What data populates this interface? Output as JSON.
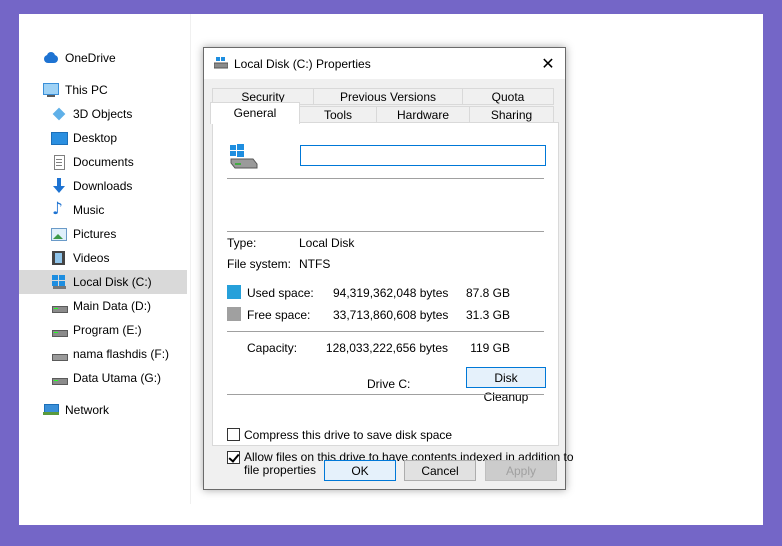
{
  "nav": {
    "items": [
      {
        "label": "OneDrive",
        "icon": "onedrive-icon"
      },
      {
        "label": "This PC",
        "icon": "this-pc-icon"
      },
      {
        "label": "3D Objects",
        "icon": "3d-objects-icon"
      },
      {
        "label": "Desktop",
        "icon": "desktop-icon"
      },
      {
        "label": "Documents",
        "icon": "documents-icon"
      },
      {
        "label": "Downloads",
        "icon": "downloads-icon"
      },
      {
        "label": "Music",
        "icon": "music-icon"
      },
      {
        "label": "Pictures",
        "icon": "pictures-icon"
      },
      {
        "label": "Videos",
        "icon": "videos-icon"
      },
      {
        "label": "Local Disk (C:)",
        "icon": "windows-drive-icon",
        "selected": true
      },
      {
        "label": "Main Data (D:)",
        "icon": "drive-icon"
      },
      {
        "label": "Program (E:)",
        "icon": "drive-icon"
      },
      {
        "label": "nama flashdis (F:)",
        "icon": "usb-drive-icon"
      },
      {
        "label": "Data Utama (G:)",
        "icon": "drive-icon"
      },
      {
        "label": "Network",
        "icon": "network-icon"
      }
    ]
  },
  "dialog": {
    "title": "Local Disk (C:) Properties",
    "close_glyph": "✕",
    "tabs_row1": [
      "Security",
      "Previous Versions",
      "Quota"
    ],
    "tabs_row2": [
      "General",
      "Tools",
      "Hardware",
      "Sharing"
    ],
    "active_tab": "General",
    "drive_name_value": "",
    "type_label": "Type:",
    "type_value": "Local Disk",
    "fs_label": "File system:",
    "fs_value": "NTFS",
    "used_label": "Used space:",
    "used_bytes": "94,319,362,048 bytes",
    "used_gb": "87.8 GB",
    "free_label": "Free space:",
    "free_bytes": "33,713,860,608 bytes",
    "free_gb": "31.3 GB",
    "capacity_label": "Capacity:",
    "capacity_bytes": "128,033,222,656 bytes",
    "capacity_gb": "119 GB",
    "drive_caption": "Drive C:",
    "disk_cleanup_label": "Disk Cleanup",
    "compress_label": "Compress this drive to save disk space",
    "compress_checked": false,
    "index_label_line1": "Allow files on this drive to have contents indexed in addition to",
    "index_label_line2": "file properties",
    "index_checked": true,
    "ok_label": "OK",
    "cancel_label": "Cancel",
    "apply_label": "Apply"
  },
  "colors": {
    "used_space": "#26a0da",
    "free_space": "#a0a0a0",
    "accent": "#0078d7",
    "backdrop": "#7466c7"
  }
}
